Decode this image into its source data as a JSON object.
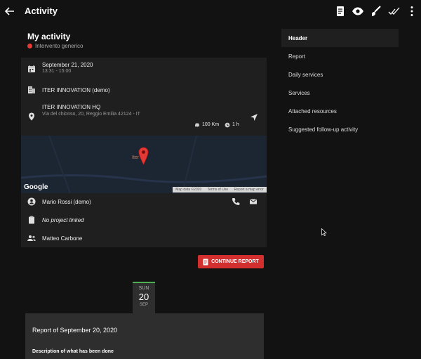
{
  "topbar": {
    "title": "Activity",
    "icons": [
      "back-arrow-icon",
      "report-icon",
      "eye-icon",
      "brush-icon",
      "double-check-icon",
      "more-vert-icon"
    ]
  },
  "activity": {
    "heading": "My activity",
    "type_label": "Intervento generico",
    "type_color": "#e53935",
    "date": "September 21, 2020",
    "time": "13:31 - 15:00",
    "company": "ITER INNOVATION (demo)",
    "location_name": "ITER INNOVATION HQ",
    "address": "Via del chionso, 20, Reggio Emilia 42124 - IT",
    "distance": "100 Km",
    "duration": "1 h",
    "contact": "Mario Rossi (demo)",
    "project": "No project linked",
    "assignee": "Matteo Carbone"
  },
  "map": {
    "logo": "Google",
    "pin_label": "Iter",
    "footer": [
      "Map data ©2020",
      "Terms of Use",
      "Report a map error"
    ]
  },
  "actions": {
    "continue_label": "CONTINUE REPORT",
    "accent": "#d32f2f"
  },
  "report_date": {
    "weekday": "SUN",
    "day": "20",
    "month": "SEP"
  },
  "report": {
    "title": "Report of September 20, 2020",
    "description_label": "Description of what has been done"
  },
  "sidebar": {
    "items": [
      {
        "label": "Header"
      },
      {
        "label": "Report"
      },
      {
        "label": "Daily services"
      },
      {
        "label": "Services"
      },
      {
        "label": "Attached resources"
      },
      {
        "label": "Suggested follow-up activity"
      }
    ]
  }
}
